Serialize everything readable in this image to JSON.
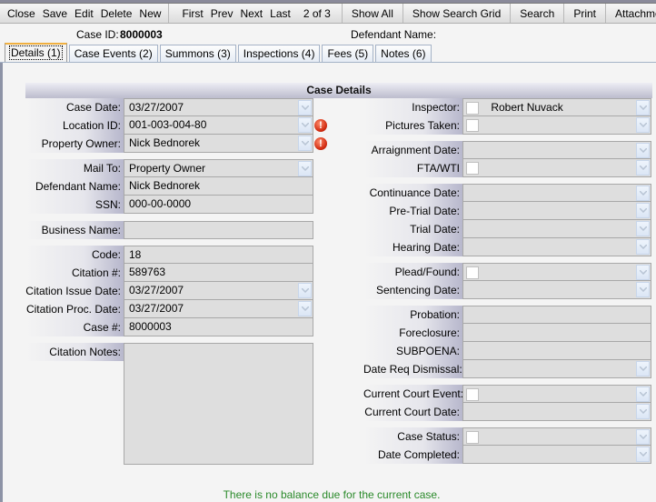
{
  "toolbar": {
    "buttons_left": [
      "Close",
      "Save",
      "Edit",
      "Delete",
      "New"
    ],
    "buttons_nav": [
      "First",
      "Prev",
      "Next",
      "Last"
    ],
    "record_position": "2 of 3",
    "show_all": "Show All",
    "show_search_grid": "Show Search Grid",
    "search": "Search",
    "print": "Print",
    "attachments": "Attachments"
  },
  "header": {
    "case_id_label": "Case ID:",
    "case_id_value": "8000003",
    "defendant_name_label": "Defendant Name:"
  },
  "tabs": [
    {
      "label": "Details (1)",
      "active": true
    },
    {
      "label": "Case Events (2)",
      "active": false
    },
    {
      "label": "Summons (3)",
      "active": false
    },
    {
      "label": "Inspections (4)",
      "active": false
    },
    {
      "label": "Fees (5)",
      "active": false
    },
    {
      "label": "Notes (6)",
      "active": false
    }
  ],
  "section_title": "Case Details",
  "left": {
    "case_date_label": "Case Date:",
    "case_date": "03/27/2007",
    "location_id_label": "Location ID:",
    "location_id": "001-003-004-80",
    "property_owner_label": "Property Owner:",
    "property_owner": "Nick Bednorek",
    "mail_to_label": "Mail To:",
    "mail_to": "Property Owner",
    "defendant_name_label": "Defendant Name:",
    "defendant_name": "Nick Bednorek",
    "ssn_label": "SSN:",
    "ssn": "000-00-0000",
    "business_name_label": "Business Name:",
    "business_name": "",
    "code_label": "Code:",
    "code": "18",
    "citation_no_label": "Citation #:",
    "citation_no": "589763",
    "citation_issue_date_label": "Citation Issue Date:",
    "citation_issue_date": "03/27/2007",
    "citation_proc_date_label": "Citation Proc. Date:",
    "citation_proc_date": "03/27/2007",
    "case_no_label": "Case #:",
    "case_no": "8000003",
    "citation_notes_label": "Citation Notes:",
    "citation_notes": ""
  },
  "right": {
    "inspector_label": "Inspector:",
    "inspector": "Robert Nuvack",
    "pictures_taken_label": "Pictures Taken:",
    "arraignment_date_label": "Arraignment Date:",
    "fta_wti_label": "FTA/WTI",
    "continuance_date_label": "Continuance Date:",
    "pre_trial_date_label": "Pre-Trial Date:",
    "trial_date_label": "Trial Date:",
    "hearing_date_label": "Hearing Date:",
    "plead_found_label": "Plead/Found:",
    "sentencing_date_label": "Sentencing Date:",
    "probation_label": "Probation:",
    "foreclosure_label": "Foreclosure:",
    "subpoena_label": "SUBPOENA:",
    "date_req_dismissal_label": "Date Req Dismissal:",
    "current_court_event_label": "Current Court Event:",
    "current_court_date_label": "Current Court Date:",
    "case_status_label": "Case Status:",
    "date_completed_label": "Date Completed:"
  },
  "warning_icon_glyph": "!",
  "balance_message": "There is no balance due for the current case.",
  "colors": {
    "balance_message": "#2a8a2a",
    "warning": "#d02a10",
    "active_tab_accent": "#f0b040"
  }
}
